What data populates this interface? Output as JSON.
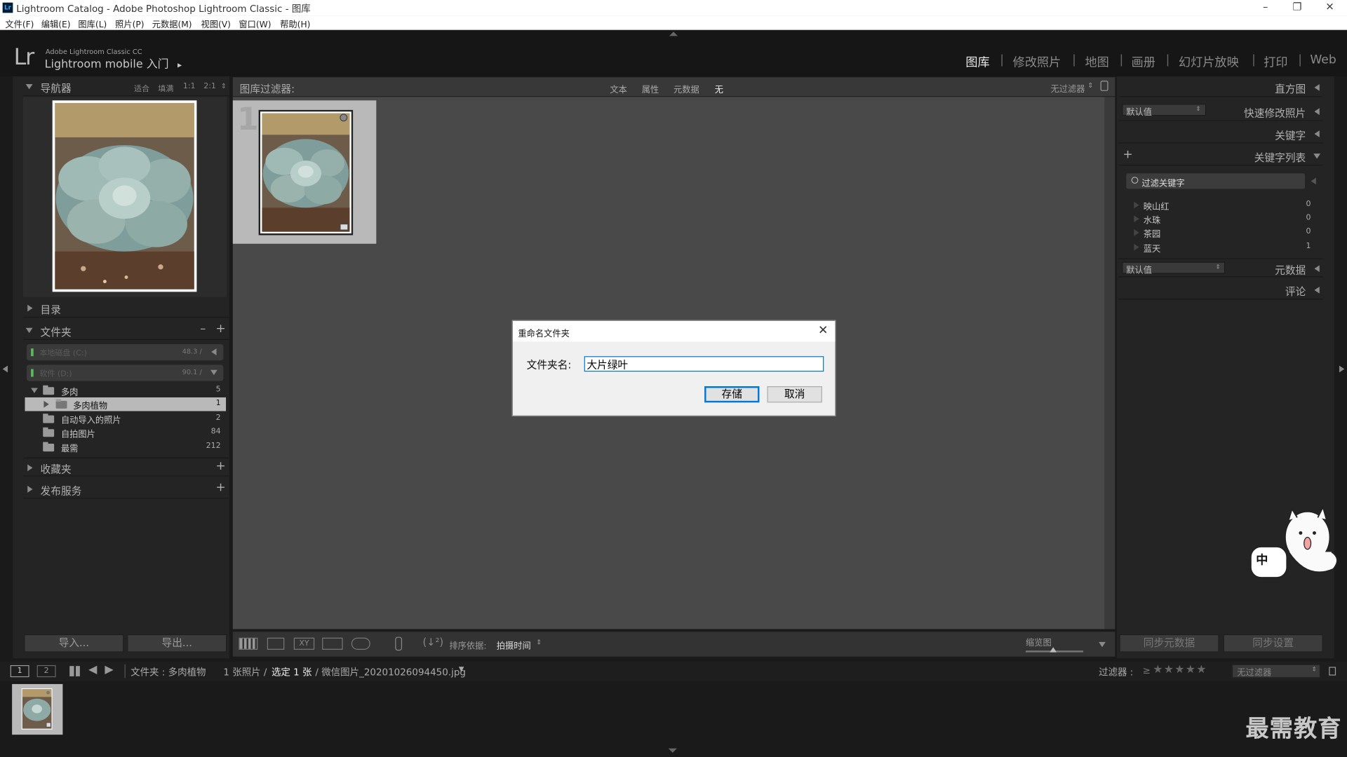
{
  "window": {
    "title": "Lightroom Catalog - Adobe Photoshop Lightroom Classic - 图库",
    "minimize": "–",
    "restore": "❐",
    "close": "✕"
  },
  "menu": [
    "文件(F)",
    "编辑(E)",
    "图库(L)",
    "照片(P)",
    "元数据(M)",
    "视图(V)",
    "窗口(W)",
    "帮助(H)"
  ],
  "identity": {
    "logo": "Lr",
    "small": "Adobe Lightroom Classic CC",
    "big": "Lightroom mobile 入门",
    "arrow": "▸"
  },
  "modules": [
    {
      "label": "图库",
      "active": true
    },
    {
      "label": "修改照片"
    },
    {
      "label": "地图"
    },
    {
      "label": "画册"
    },
    {
      "label": "幻灯片放映"
    },
    {
      "label": "打印"
    },
    {
      "label": "Web"
    }
  ],
  "module_sep": "|",
  "navigator": {
    "title": "导航器",
    "opts": [
      "适合",
      "填满",
      "1:1",
      "2:1"
    ]
  },
  "left_panels": {
    "catalog": "目录",
    "folders": "文件夹",
    "collections": "收藏夹",
    "publish": "发布服务",
    "minus": "–",
    "plus": "+"
  },
  "volumes": [
    {
      "name": "本地磁盘 (C:)",
      "size": "48.3 /"
    },
    {
      "name": "软件 (D:)",
      "size": "90.1 /"
    }
  ],
  "folders": [
    {
      "name": "多肉",
      "count": "5",
      "level": 0,
      "expanded": true
    },
    {
      "name": "多肉植物",
      "count": "1",
      "level": 1,
      "selected": true
    },
    {
      "name": "自动导入的照片",
      "count": "2",
      "level": 0
    },
    {
      "name": "自拍图片",
      "count": "84",
      "level": 0
    },
    {
      "name": "最需",
      "count": "212",
      "level": 0
    }
  ],
  "buttons": {
    "import": "导入...",
    "export": "导出..."
  },
  "filter_bar": {
    "label": "图库过滤器:",
    "text": "文本",
    "attr": "属性",
    "meta": "元数据",
    "none": "无",
    "preset": "无过滤器"
  },
  "grid": {
    "cell_index": "1"
  },
  "dialog": {
    "title": "重命名文件夹",
    "label": "文件夹名:",
    "value": "大片绿叶",
    "save": "存储",
    "cancel": "取消",
    "close": "✕"
  },
  "toolbar": {
    "sort_label": "排序依据:",
    "sort_value": "拍摄时间",
    "thumb_label": "缩览图"
  },
  "right_panel": {
    "histogram": "直方图",
    "quick_develop": "快速修改照片",
    "preset": "默认值",
    "keywording": "关键字",
    "keyword_list": "关键字列表",
    "add": "+",
    "filter_placeholder": "过滤关键字",
    "metadata": "元数据",
    "metadata_preset": "默认值",
    "comments": "评论",
    "sync_meta": "同步元数据",
    "sync_settings": "同步设置"
  },
  "keywords": [
    {
      "name": "映山红",
      "count": "0"
    },
    {
      "name": "水珠",
      "count": "0"
    },
    {
      "name": "茶园",
      "count": "0"
    },
    {
      "name": "蓝天",
      "count": "1"
    }
  ],
  "filmstrip": {
    "screen1": "1",
    "screen2": "2",
    "path": "文件夹 : 多肉植物",
    "count_text": "1 张照片 /",
    "selected": "选定 1 张",
    "filename": "/ 微信图片_20201026094450.jpg",
    "filter_label": "过滤器 :",
    "filter_value": "无过滤器",
    "stars": "★★★★★",
    "geq": "≥"
  },
  "ime_sticker": {
    "text": "中"
  },
  "watermark": "最需教育",
  "colors": {
    "panel": "#2a2a2a",
    "grid": "#494949",
    "accent": "#0078d7",
    "selected_cell": "#b9b9b9"
  }
}
